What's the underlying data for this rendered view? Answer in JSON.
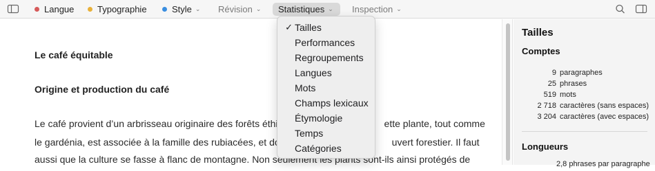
{
  "toolbar": {
    "tabs": [
      {
        "label": "Langue",
        "dot": "#d65a5a"
      },
      {
        "label": "Typographie",
        "dot": "#e8b13a"
      },
      {
        "label": "Style",
        "dot": "#3a8ee0"
      },
      {
        "label": "Révision"
      },
      {
        "label": "Statistiques"
      },
      {
        "label": "Inspection"
      }
    ],
    "chevron": "⌵",
    "icons": [
      "sidebar-icon",
      "search-icon",
      "inspector-icon"
    ]
  },
  "document": {
    "title": "Le café équitable",
    "section": "Origine et production du café",
    "lines": [
      "Le café provient d’un arbrisseau originaire des forêts éthi",
      "ette plante, tout comme",
      "le gardénia, est associée à la famille des rubiacées, et do",
      "uvert forestier. Il faut",
      "aussi que la culture se fasse à flanc de montagne. Non seulement les plants sont-ils ainsi protégés de"
    ]
  },
  "dropdown": {
    "check": "✓",
    "items": [
      "Tailles",
      "Performances",
      "Regroupements",
      "Langues",
      "Mots",
      "Champs lexicaux",
      "Étymologie",
      "Temps",
      "Catégories"
    ]
  },
  "sidebar": {
    "title": "Tailles",
    "comptes": {
      "heading": "Comptes",
      "rows": [
        {
          "num": "9",
          "label": "paragraphes"
        },
        {
          "num": "25",
          "label": "phrases"
        },
        {
          "num": "519",
          "label": "mots"
        },
        {
          "num": "2 718",
          "label": "caractères (sans espaces)"
        },
        {
          "num": "3 204",
          "label": "caractères (avec espaces)"
        }
      ]
    },
    "longueurs": {
      "heading": "Longueurs",
      "partial_row": "2,8 phrases par paragraphe"
    }
  }
}
